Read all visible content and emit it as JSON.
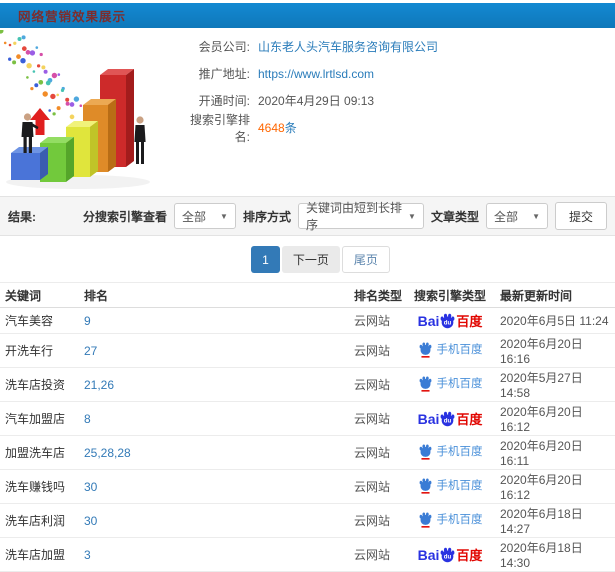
{
  "header": {
    "title": "网络营销效果展示"
  },
  "info": {
    "fields": [
      {
        "label": "会员公司:",
        "value": "山东老人头汽车服务咨询有限公司"
      },
      {
        "label": "推广地址:",
        "value": "https://www.lrtlsd.com"
      },
      {
        "label": "开通时间:",
        "value": "2020年4月29日 09:13"
      },
      {
        "label": "搜索引擎排名:",
        "count": "4648",
        "unit": "条"
      }
    ]
  },
  "filters": {
    "result_label": "结果:",
    "engine_label": "分搜索引擎查看",
    "engine_value": "全部",
    "sort_label": "排序方式",
    "sort_value": "关键词由短到长排序",
    "article_label": "文章类型",
    "article_value": "全部",
    "submit_label": "提交"
  },
  "pagination": {
    "current": "1",
    "next": "下一页",
    "last": "尾页"
  },
  "table": {
    "headers": [
      "关键词",
      "排名",
      "排名类型",
      "搜索引擎类型",
      "最新更新时间"
    ],
    "rows": [
      {
        "keyword": "汽车美容",
        "rank": "9",
        "rank_type": "云网站",
        "engine": "baidu",
        "updated": "2020年6月5日 11:24"
      },
      {
        "keyword": "开洗车行",
        "rank": "27",
        "rank_type": "云网站",
        "engine": "mobile-baidu",
        "updated": "2020年6月20日 16:16"
      },
      {
        "keyword": "洗车店投资",
        "rank": "21,26",
        "rank_type": "云网站",
        "engine": "mobile-baidu",
        "updated": "2020年5月27日 14:58"
      },
      {
        "keyword": "汽车加盟店",
        "rank": "8",
        "rank_type": "云网站",
        "engine": "baidu",
        "updated": "2020年6月20日 16:12"
      },
      {
        "keyword": "加盟洗车店",
        "rank": "25,28,28",
        "rank_type": "云网站",
        "engine": "mobile-baidu",
        "updated": "2020年6月20日 16:11"
      },
      {
        "keyword": "洗车赚钱吗",
        "rank": "30",
        "rank_type": "云网站",
        "engine": "mobile-baidu",
        "updated": "2020年6月20日 16:12"
      },
      {
        "keyword": "洗车店利润",
        "rank": "30",
        "rank_type": "云网站",
        "engine": "mobile-baidu",
        "updated": "2020年6月18日 14:27"
      },
      {
        "keyword": "洗车店加盟",
        "rank": "3",
        "rank_type": "云网站",
        "engine": "baidu",
        "updated": "2020年6月18日 14:30"
      }
    ]
  },
  "engine_logos": {
    "baidu": {
      "bai": "Bai",
      "du": "du",
      "cn": "百度"
    },
    "mobile": {
      "label": "手机百度"
    }
  },
  "colors": {
    "header_bg": "#1181c6",
    "header_title": "#7c2d2d",
    "link": "#2a7cba",
    "count": "#ff6600",
    "pagination_active": "#337ab7",
    "baidu_blue": "#2932e1",
    "baidu_red": "#e10601",
    "mobile_blue": "#4a90d9"
  }
}
